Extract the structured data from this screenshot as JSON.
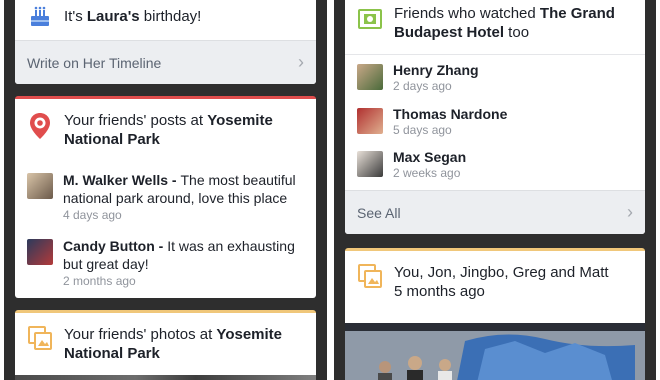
{
  "left": {
    "birthday": {
      "text_prefix": "It's ",
      "name": "Laura's",
      "text_suffix": " birthday!",
      "action": "Write on Her Timeline"
    },
    "posts": {
      "title_prefix": "Your friends' posts at ",
      "place": "Yosemite National Park",
      "items": [
        {
          "author": "M. Walker Wells",
          "sep": " - ",
          "text": "The most beautiful national park around, love this place",
          "time": "4 days ago"
        },
        {
          "author": "Candy Button",
          "sep": " - ",
          "text": "It was an exhausting but great day!",
          "time": "2 months ago"
        }
      ]
    },
    "photos": {
      "title_prefix": "Your friends' photos at ",
      "place": "Yosemite National Park"
    }
  },
  "right": {
    "movie": {
      "title_prefix": "Friends who watched ",
      "movie": "The Grand Budapest Hotel",
      "title_suffix": " too",
      "friends": [
        {
          "name": "Henry Zhang",
          "time": "2 days ago"
        },
        {
          "name": "Thomas Nardone",
          "time": "5 days ago"
        },
        {
          "name": "Max Segan",
          "time": "2 weeks ago"
        }
      ],
      "see_all": "See All"
    },
    "memory": {
      "title": "You, Jon, Jingbo, Greg and Matt",
      "time": "5 months ago"
    }
  },
  "colors": {
    "accent_red": "#e04d4d",
    "accent_orange": "#f0c77a",
    "icon_green": "#8bc34a"
  },
  "icons": [
    "birthday-cake-icon",
    "location-pin-icon",
    "photos-icon",
    "movie-icon",
    "chevron-right-icon"
  ]
}
